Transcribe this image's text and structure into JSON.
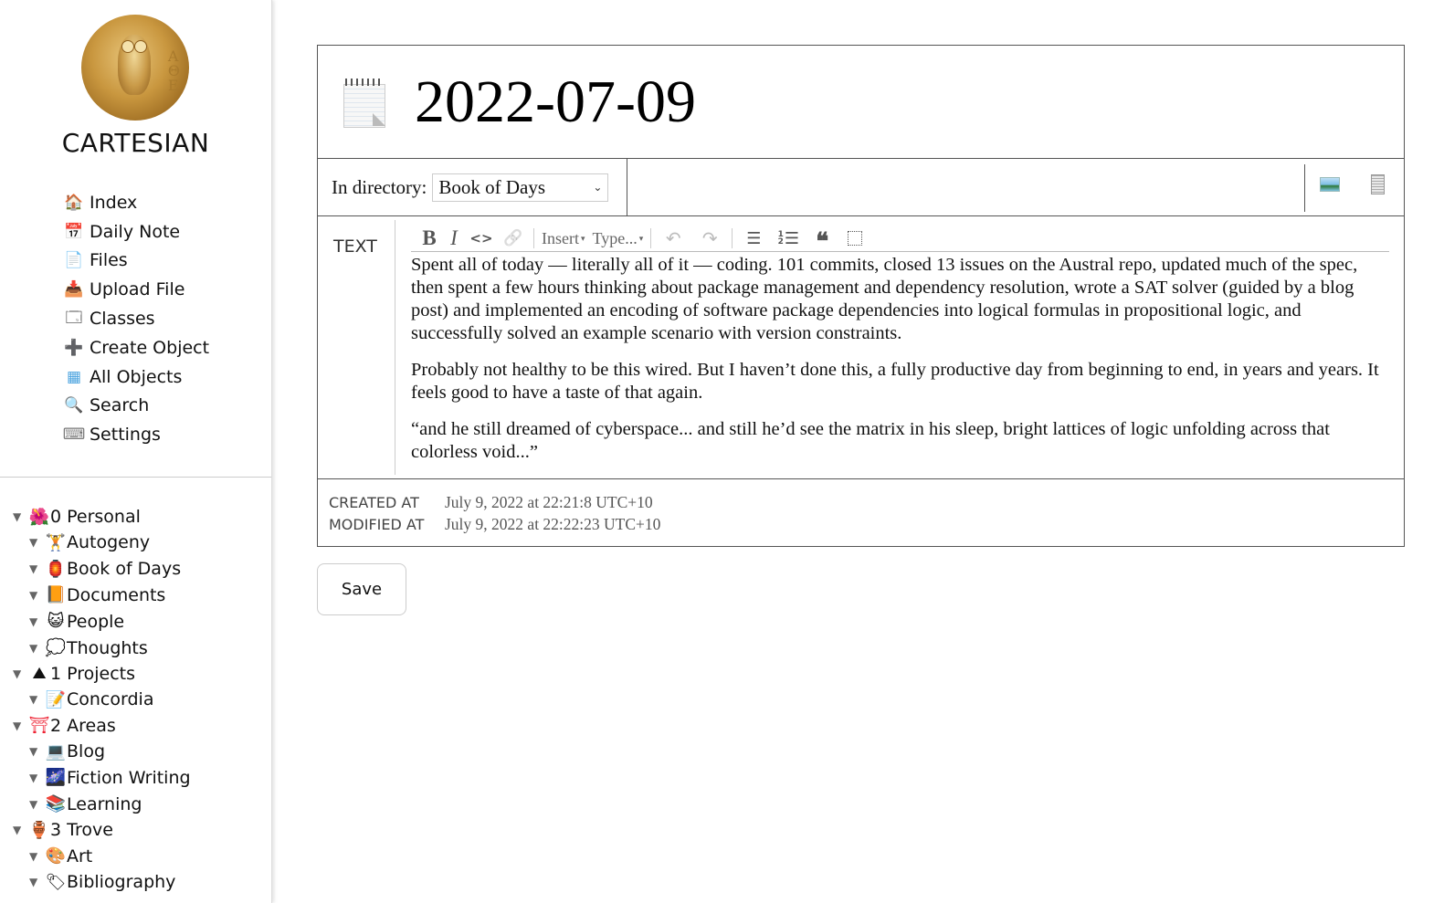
{
  "app": {
    "brand": "CARTESIAN",
    "logo_icon": "owl-coin-logo"
  },
  "nav": {
    "items": [
      {
        "label": "Index",
        "icon": "house-icon",
        "glyph": "🏠"
      },
      {
        "label": "Daily Note",
        "icon": "calendar-icon",
        "glyph": "📅"
      },
      {
        "label": "Files",
        "icon": "document-icon",
        "glyph": "📄"
      },
      {
        "label": "Upload File",
        "icon": "upload-icon",
        "glyph": "📥"
      },
      {
        "label": "Classes",
        "icon": "window-icon",
        "glyph": "🗔"
      },
      {
        "label": "Create Object",
        "icon": "plus-icon",
        "glyph": "➕"
      },
      {
        "label": "All Objects",
        "icon": "table-icon",
        "glyph": "▦"
      },
      {
        "label": "Search",
        "icon": "magnifier-icon",
        "glyph": "🔍"
      },
      {
        "label": "Settings",
        "icon": "keyboard-icon",
        "glyph": "⌨"
      }
    ]
  },
  "tree": {
    "items": [
      {
        "level": 0,
        "label": "0 Personal",
        "emoji": "🌺",
        "icon": "hibiscus-icon"
      },
      {
        "level": 1,
        "label": "Autogeny",
        "emoji": "🏋",
        "icon": "weightlifter-icon"
      },
      {
        "level": 1,
        "label": "Book of Days",
        "emoji": "🏮",
        "icon": "lantern-icon"
      },
      {
        "level": 1,
        "label": "Documents",
        "emoji": "📙",
        "icon": "orange-book-icon"
      },
      {
        "level": 1,
        "label": "People",
        "emoji": "😺",
        "icon": "cat-face-icon"
      },
      {
        "level": 1,
        "label": "Thoughts",
        "emoji": "💭",
        "icon": "thought-bubble-icon"
      },
      {
        "level": 0,
        "label": "1 Projects",
        "emoji": "⛰",
        "icon": "mountain-icon"
      },
      {
        "level": 1,
        "label": "Concordia",
        "emoji": "📝",
        "icon": "memo-icon"
      },
      {
        "level": 0,
        "label": "2 Areas",
        "emoji": "⛩",
        "icon": "torii-gate-icon"
      },
      {
        "level": 1,
        "label": "Blog",
        "emoji": "💻",
        "icon": "laptop-icon"
      },
      {
        "level": 1,
        "label": "Fiction Writing",
        "emoji": "🌌",
        "icon": "night-sky-icon"
      },
      {
        "level": 1,
        "label": "Learning",
        "emoji": "📚",
        "icon": "books-icon"
      },
      {
        "level": 0,
        "label": "3 Trove",
        "emoji": "🏺",
        "icon": "amphora-icon"
      },
      {
        "level": 1,
        "label": "Art",
        "emoji": "🎨",
        "icon": "palette-icon"
      },
      {
        "level": 1,
        "label": "Bibliography",
        "emoji": "🏷",
        "icon": "tag-icon"
      }
    ],
    "expand_glyph": "▼"
  },
  "object": {
    "title": "2022-07-09",
    "icon": "notepad-icon",
    "directory_label": "In directory:",
    "directory_value": "Book of Days",
    "views": [
      "image-view-icon",
      "document-view-icon"
    ]
  },
  "editor": {
    "field_label": "TEXT",
    "toolbar": {
      "bold": "B",
      "italic": "I",
      "code": "<>",
      "link": "🔗",
      "insert": "Insert",
      "type": "Type...",
      "caret": "▾",
      "undo": "↶",
      "redo": "↷",
      "bullet_list": "☰",
      "ordered_list": "☰",
      "quote": "❝",
      "block": ""
    },
    "paragraphs": [
      "Spent all of today — literally all of it — coding. 101 commits, closed 13 issues on the Austral repo, updated much of the spec, then spent a few hours thinking about package management and dependency resolution, wrote a SAT solver (guided by a blog post) and implemented an encoding of software package dependencies into logical formulas in propositional logic, and successfully solved an example scenario with version constraints.",
      "Probably not healthy to be this wired. But I haven’t done this, a fully productive day from beginning to end, in years and years. It feels good to have a taste of that again.",
      "“and he still dreamed of cyberspace... and still he’d see the matrix in his sleep, bright lattices of logic unfolding across that colorless void...”"
    ]
  },
  "meta": {
    "created_label": "CREATED AT",
    "created_value": "July 9, 2022 at 22:21:8 UTC+10",
    "modified_label": "MODIFIED AT",
    "modified_value": "July 9, 2022 at 22:22:23 UTC+10"
  },
  "actions": {
    "save_label": "Save"
  }
}
